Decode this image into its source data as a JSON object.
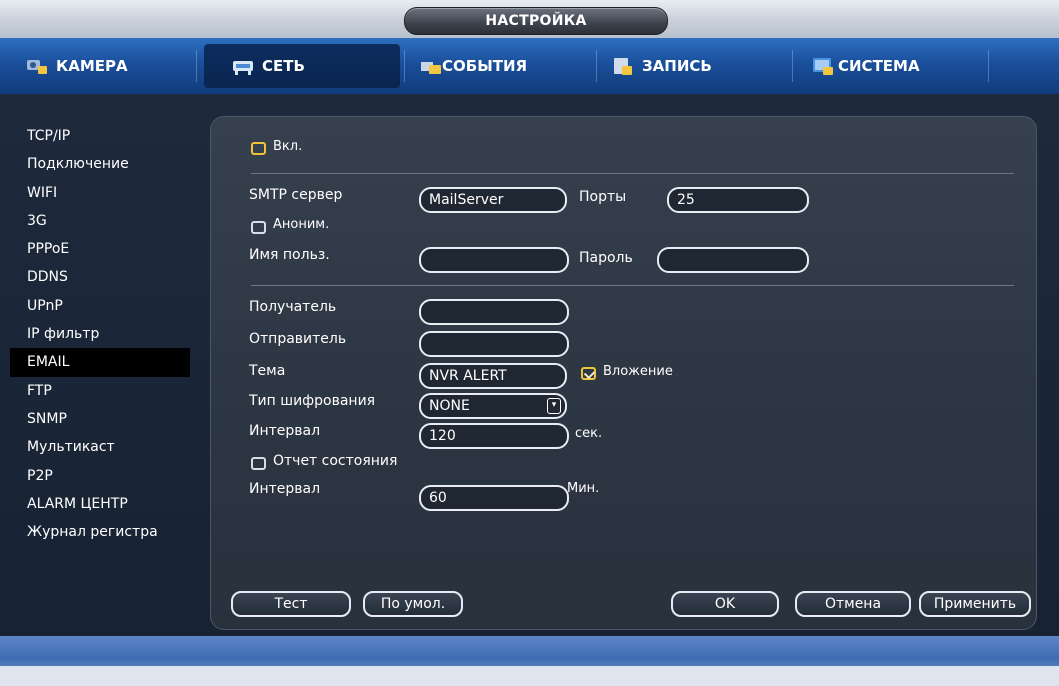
{
  "window": {
    "title": "НАСТРОЙКА"
  },
  "tabs": [
    {
      "label": "КАМЕРА",
      "icon": "camera-icon"
    },
    {
      "label": "СЕТЬ",
      "icon": "network-icon",
      "active": true
    },
    {
      "label": "СОБЫТИЯ",
      "icon": "events-icon"
    },
    {
      "label": "ЗАПИСЬ",
      "icon": "record-icon"
    },
    {
      "label": "СИСТЕМА",
      "icon": "system-icon"
    }
  ],
  "sidebar": {
    "items": [
      "TCP/IP",
      "Подключение",
      "WIFI",
      "3G",
      "PPPoE",
      "DDNS",
      "UPnP",
      "IP фильтр",
      "EMAIL",
      "FTP",
      "SNMP",
      "Мультикаст",
      "P2P",
      "ALARM ЦЕНТР",
      "Журнал регистра"
    ],
    "active_index": 8
  },
  "email": {
    "enable_label": "Вкл.",
    "enable_checked": false,
    "smtp_label": "SMTP сервер",
    "smtp_value": "MailServer",
    "port_label": "Порты",
    "port_value": "25",
    "anon_label": "Аноним.",
    "anon_checked": false,
    "user_label": "Имя польз.",
    "user_value": "",
    "pass_label": "Пароль",
    "pass_value": "",
    "recipient_label": "Получатель",
    "recipient_value": "",
    "sender_label": "Отправитель",
    "sender_value": "",
    "subject_label": "Тема",
    "subject_value": "NVR ALERT",
    "attach_label": "Вложение",
    "attach_checked": true,
    "encrypt_label": "Тип шифрования",
    "encrypt_value": "NONE",
    "interval_label": "Интервал",
    "interval_value": "120",
    "interval_unit": "сек.",
    "health_label": "Отчет состояния",
    "health_checked": false,
    "health_interval_label": "Интервал",
    "health_interval_value": "60",
    "health_interval_unit": "Мин."
  },
  "buttons": {
    "test": "Тест",
    "default": "По умол.",
    "ok": "OK",
    "cancel": "Отмена",
    "apply": "Применить"
  },
  "colors": {
    "accent": "#f0c43a",
    "tab_bar": "#1a4f9b",
    "panel": "#2c3542"
  }
}
